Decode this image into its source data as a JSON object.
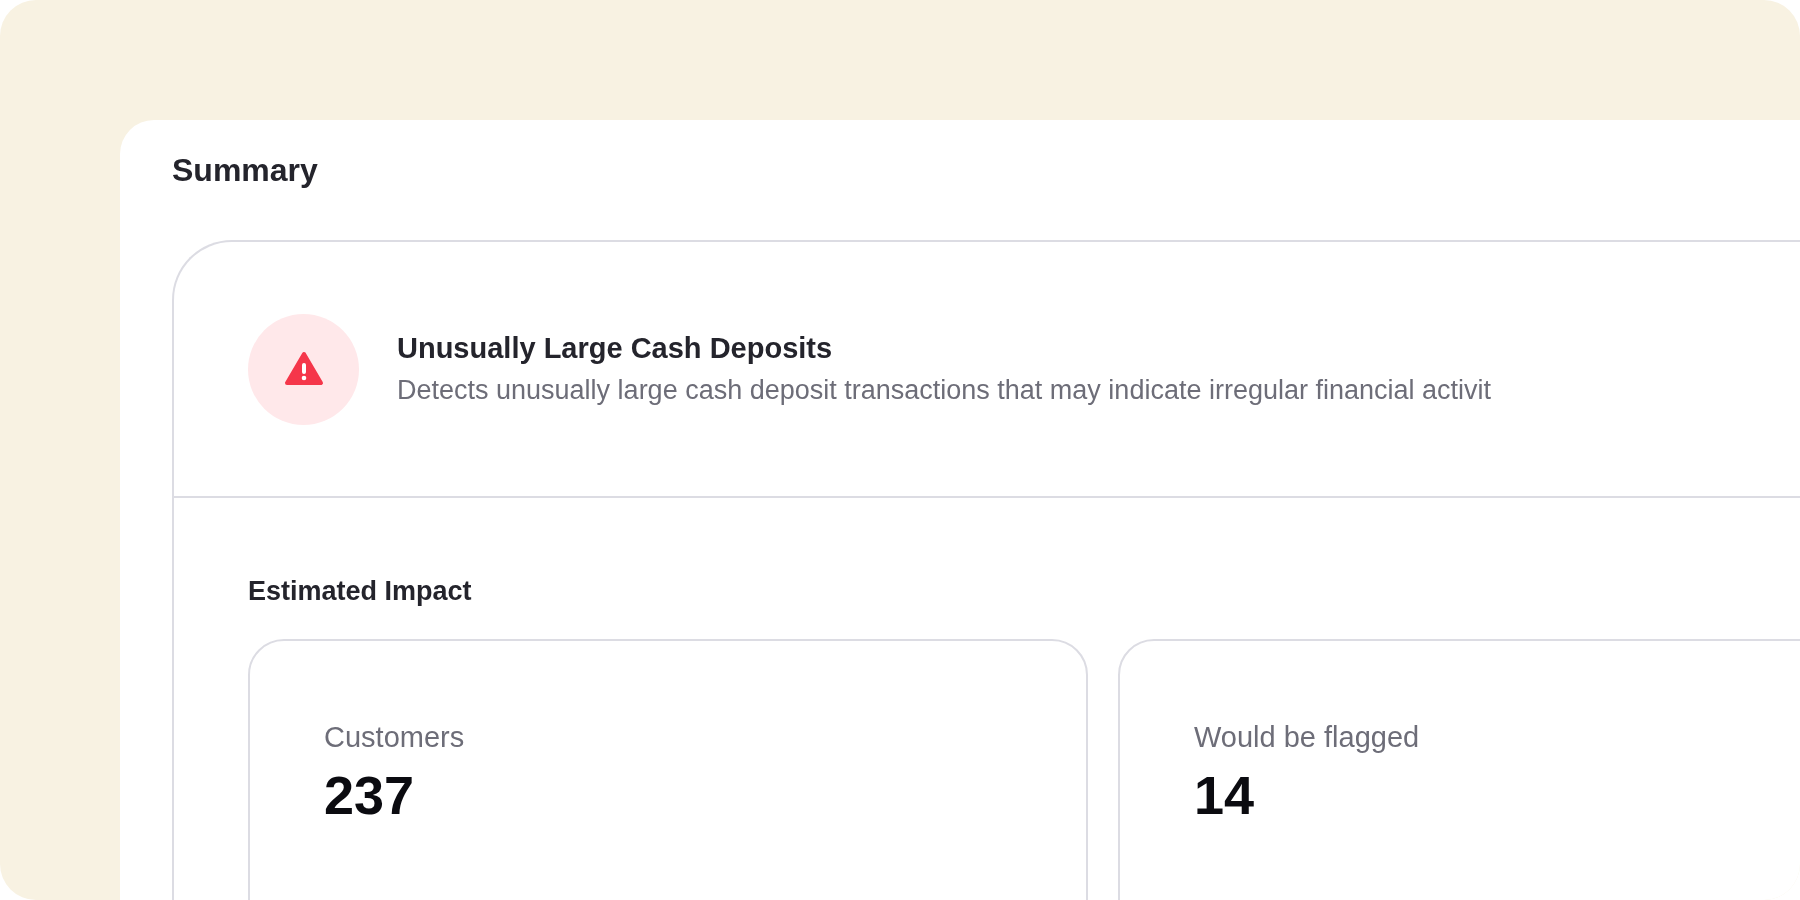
{
  "panel": {
    "title": "Summary"
  },
  "rule": {
    "title": "Unusually Large Cash Deposits",
    "description": "Detects unusually large cash deposit transactions that may indicate irregular financial activit"
  },
  "impact": {
    "title": "Estimated Impact",
    "metrics": [
      {
        "label": "Customers",
        "value": "237"
      },
      {
        "label": "Would be flagged",
        "value": "14"
      }
    ]
  }
}
